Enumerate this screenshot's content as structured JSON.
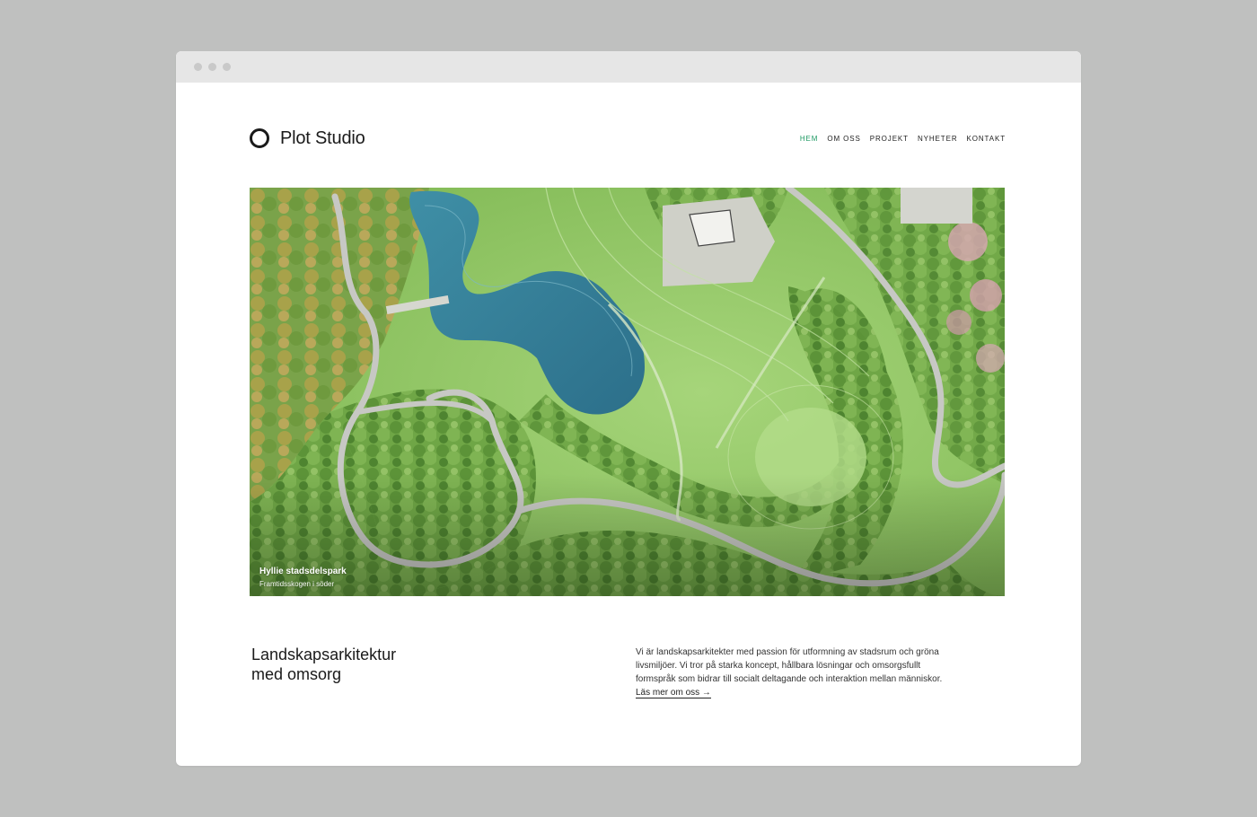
{
  "site": {
    "logo_text": "Plot Studio",
    "accent_color": "#1e9a63"
  },
  "nav": {
    "items": [
      {
        "label": "HEM",
        "active": true
      },
      {
        "label": "OM OSS",
        "active": false
      },
      {
        "label": "PROJEKT",
        "active": false
      },
      {
        "label": "NYHETER",
        "active": false
      },
      {
        "label": "KONTAKT",
        "active": false
      }
    ]
  },
  "hero": {
    "image_subject": "aerial-park-plan",
    "title": "Hyllie stadsdelspark",
    "subtitle": "Framtidsskogen i söder"
  },
  "intro": {
    "tagline_line1": "Landskapsarkitektur",
    "tagline_line2": "med omsorg",
    "body": "Vi är landskapsarkitekter med passion för utformning av stadsrum och gröna livsmiljöer. Vi tror på starka koncept, hållbara lösningar och omsorgsfullt formspråk som bidrar till socialt deltagande och interaktion mellan människor.",
    "link_label": "Läs mer om oss",
    "link_arrow": "→"
  }
}
